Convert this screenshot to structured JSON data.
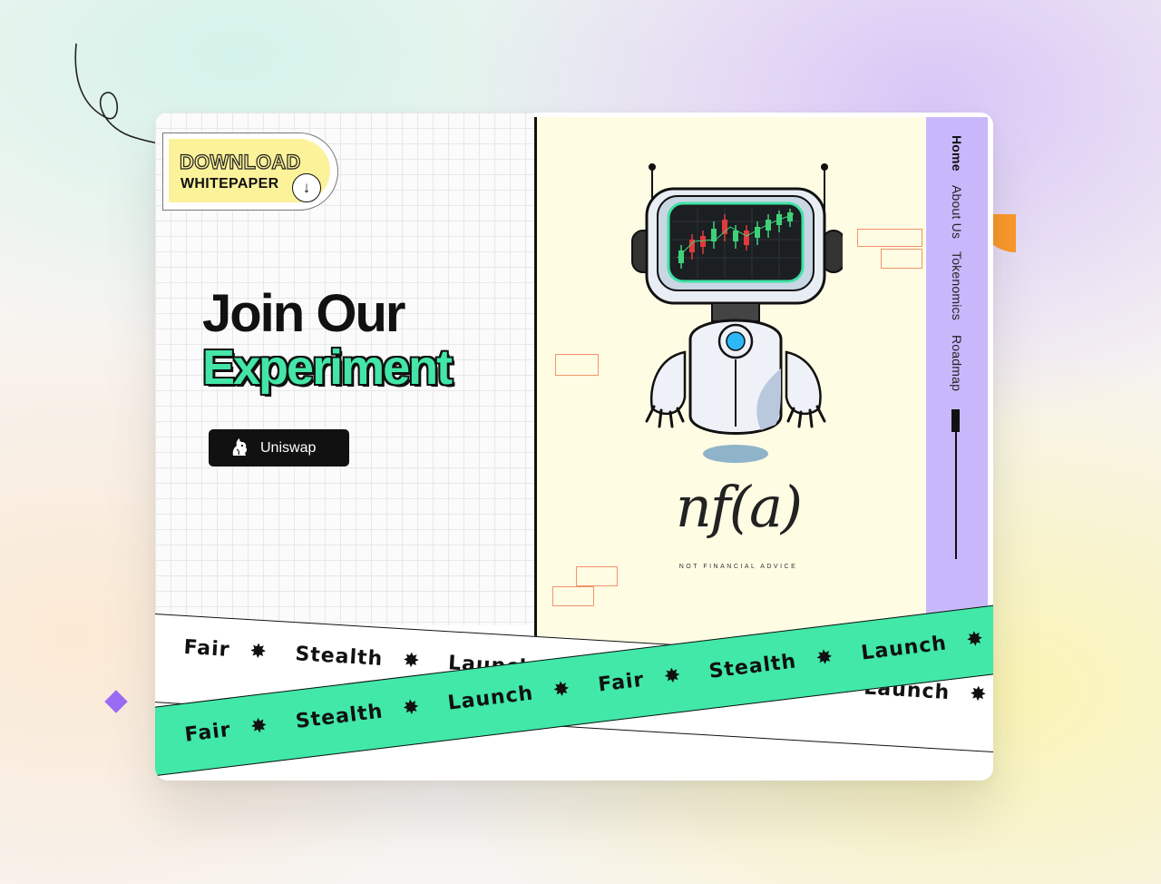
{
  "download_button": {
    "line1": "DOWNLOAD",
    "line2": "WHITEPAPER",
    "arrow": "↓"
  },
  "hero": {
    "title_line1": "Join Our",
    "title_line2": "Experiment"
  },
  "uniswap_button": {
    "label": "Uniswap",
    "icon": "uniswap-unicorn-icon"
  },
  "logo": {
    "text": "nf(a)",
    "subtitle": "NOT FINANCIAL ADVICE"
  },
  "nav": {
    "items": [
      {
        "label": "Home",
        "active": true
      },
      {
        "label": "About Us",
        "active": false
      },
      {
        "label": "Tokenomics",
        "active": false
      },
      {
        "label": "Roadmap",
        "active": false
      }
    ]
  },
  "banner": {
    "words": [
      "Fair",
      "Stealth",
      "Launch"
    ],
    "separator": "✸"
  },
  "colors": {
    "accent_green": "#41e8a8",
    "nav_purple": "#c8b8fb",
    "cream": "#fffce4",
    "yellow": "#fbf29a",
    "orange": "#fb9a2c"
  }
}
